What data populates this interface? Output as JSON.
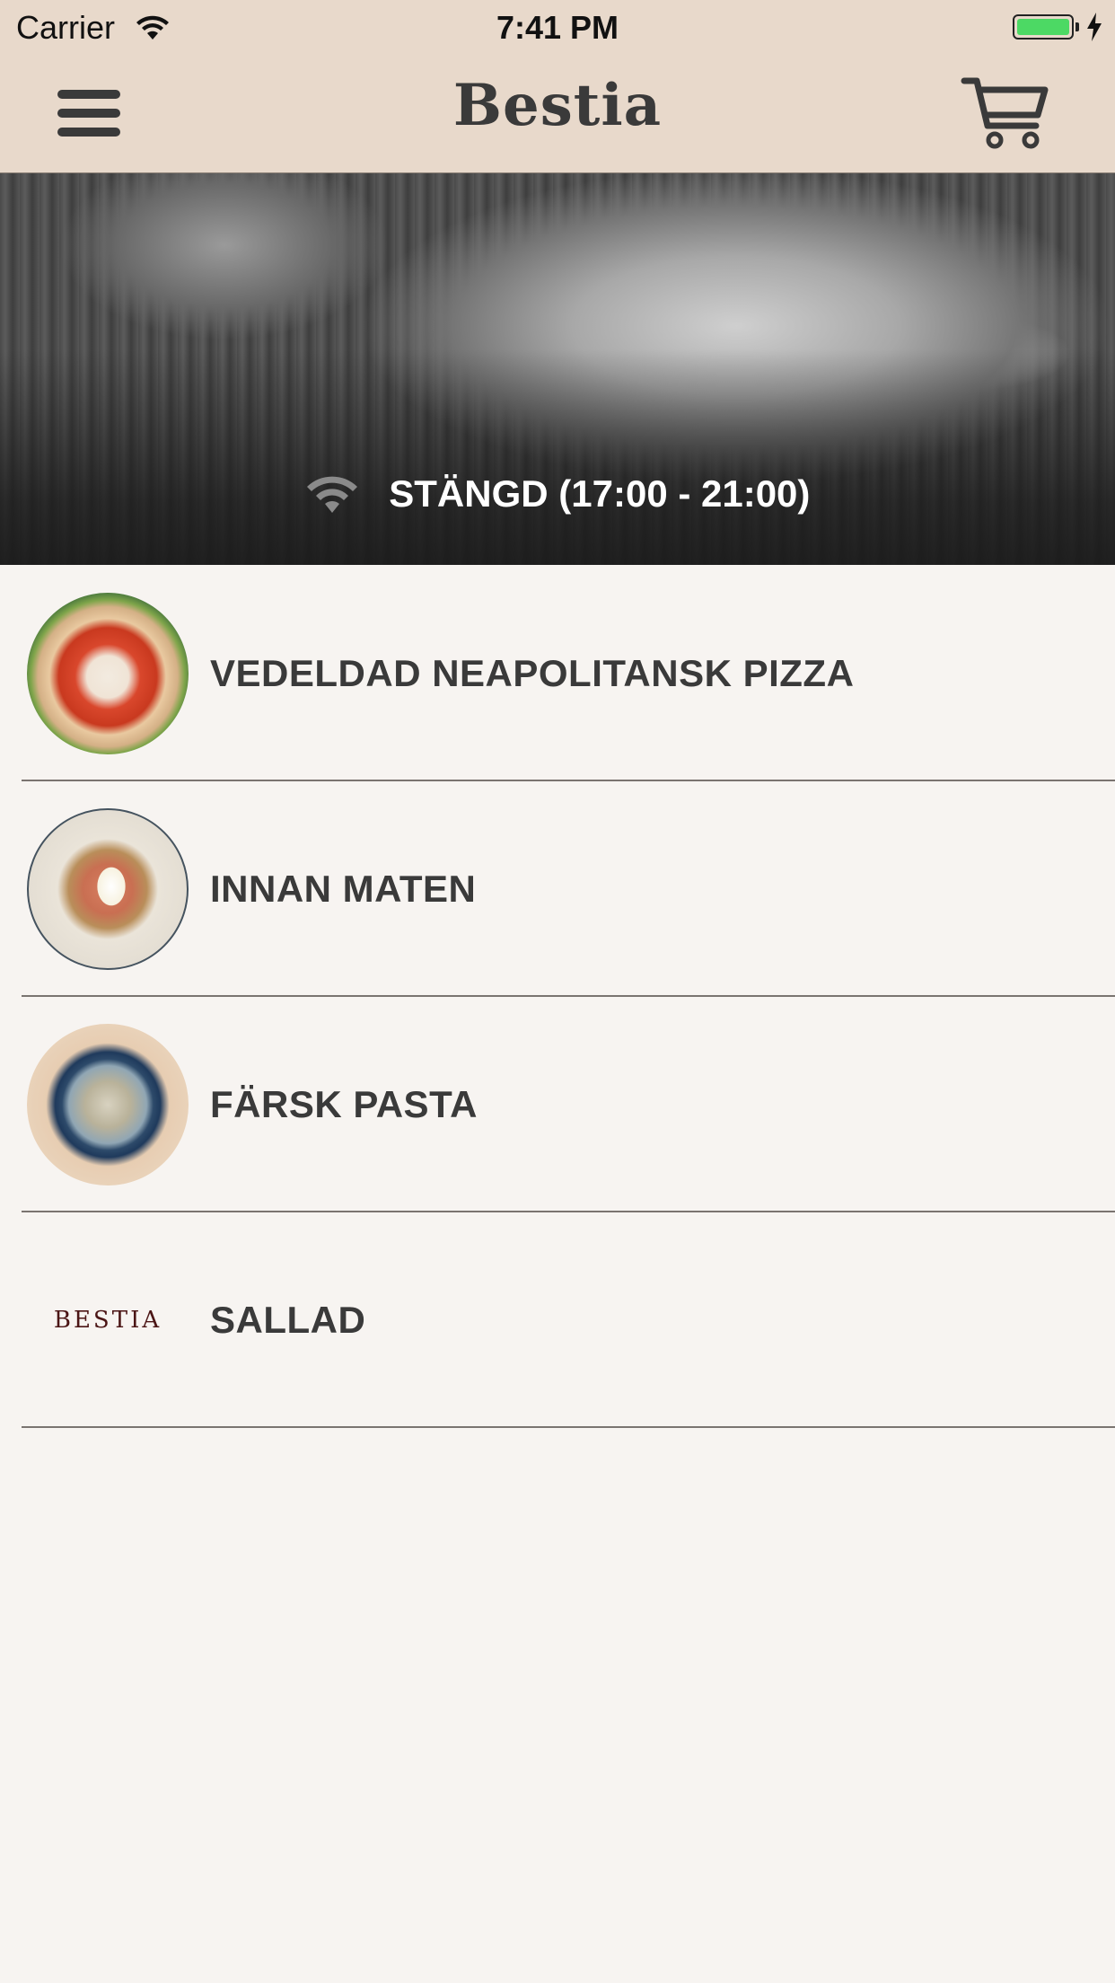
{
  "status_bar": {
    "carrier": "Carrier",
    "time": "7:41 PM",
    "battery_color": "#4cd964"
  },
  "nav": {
    "title": "Bestia",
    "menu_icon": "hamburger-menu-icon",
    "cart_icon": "shopping-cart-icon",
    "background": "#e8d9cb"
  },
  "hero": {
    "status_icon": "wifi-icon",
    "status_text": "STÄNGD (17:00 - 21:00)"
  },
  "categories": [
    {
      "label": "VEDELDAD NEAPOLITANSK PIZZA",
      "image": "pizza-photo"
    },
    {
      "label": "INNAN MATEN",
      "image": "starter-photo"
    },
    {
      "label": "FÄRSK PASTA",
      "image": "pasta-photo"
    },
    {
      "label": "SALLAD",
      "image": "bestia-logo",
      "logo_text": "BESTIA"
    }
  ]
}
